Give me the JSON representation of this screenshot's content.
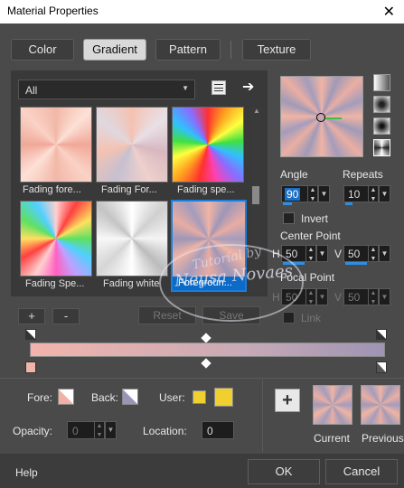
{
  "window": {
    "title": "Material Properties",
    "close_glyph": "✕"
  },
  "tabs": [
    {
      "label": "Color",
      "active": false
    },
    {
      "label": "Gradient",
      "active": true
    },
    {
      "label": "Pattern",
      "active": false
    },
    {
      "label": "Texture",
      "active": false
    }
  ],
  "category": {
    "value": "All"
  },
  "gradients": [
    {
      "label": "Fading fore...",
      "selected": false
    },
    {
      "label": "Fading For...",
      "selected": false
    },
    {
      "label": "Fading spe...",
      "selected": false
    },
    {
      "label": "Fading Spe...",
      "selected": false
    },
    {
      "label": "Fading white",
      "selected": false
    },
    {
      "label": "Foregroun...",
      "selected": true
    }
  ],
  "list_buttons": {
    "add": "+",
    "remove": "-",
    "reset": "Reset",
    "save": "Save"
  },
  "angle": {
    "label": "Angle",
    "value": "90"
  },
  "repeats": {
    "label": "Repeats",
    "value": "10"
  },
  "invert": {
    "label": "Invert",
    "checked": false
  },
  "center_point": {
    "label": "Center Point",
    "h_label": "H",
    "h_value": "50",
    "v_label": "V",
    "v_value": "50"
  },
  "focal_point": {
    "label": "Focal Point",
    "h_label": "H",
    "h_value": "50",
    "v_label": "V",
    "v_value": "50"
  },
  "link": {
    "label": "Link",
    "checked": false
  },
  "watermark": {
    "line1": "Tutorial by",
    "line2": "Neusa Novaes"
  },
  "bottom": {
    "fore_label": "Fore:",
    "back_label": "Back:",
    "user_label": "User:",
    "opacity_label": "Opacity:",
    "opacity_value": "0",
    "location_label": "Location:",
    "location_value": "0",
    "add_glyph": "+",
    "current_label": "Current",
    "previous_label": "Previous"
  },
  "colors": {
    "fore": "#f0b0a4",
    "back": "#9a94b8",
    "user": "#f0d030"
  },
  "footer": {
    "help": "Help",
    "ok": "OK",
    "cancel": "Cancel"
  }
}
